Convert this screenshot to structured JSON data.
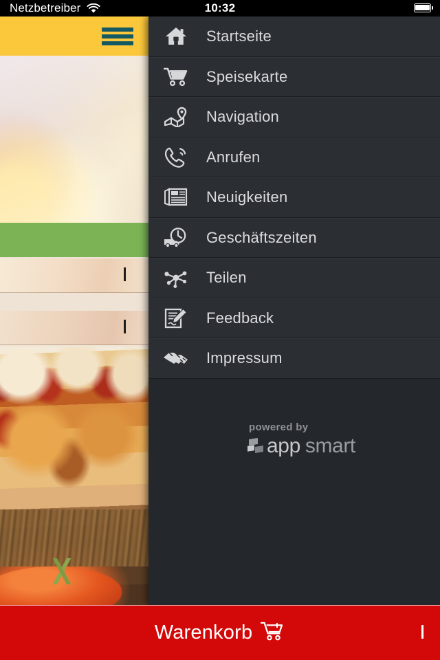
{
  "status_bar": {
    "carrier": "Netzbetreiber",
    "time": "10:32",
    "wifi_icon": "wifi-icon",
    "battery_icon": "battery-full-icon"
  },
  "app_behind": {
    "menu_button_icon": "hamburger-icon",
    "topbar_color": "#FBC83C",
    "accent_bar_color": "#7CB455",
    "rows": [
      {
        "chevron_icon": "chevron-right-icon"
      },
      {
        "chevron_icon": "chevron-right-icon"
      }
    ]
  },
  "drawer": {
    "background_color": "#24272C",
    "items": [
      {
        "label": "Startseite",
        "icon": "home-icon"
      },
      {
        "label": "Speisekarte",
        "icon": "shopping-cart-icon"
      },
      {
        "label": "Navigation",
        "icon": "map-pin-icon"
      },
      {
        "label": "Anrufen",
        "icon": "phone-icon"
      },
      {
        "label": "Neuigkeiten",
        "icon": "newspaper-icon"
      },
      {
        "label": "Geschäftszeiten",
        "icon": "delivery-clock-icon"
      },
      {
        "label": "Teilen",
        "icon": "share-icon"
      },
      {
        "label": "Feedback",
        "icon": "form-pencil-icon"
      },
      {
        "label": "Impressum",
        "icon": "handshake-icon"
      }
    ],
    "branding": {
      "powered_by": "powered by",
      "name_part_1": "app",
      "name_part_2": "smart",
      "logo_icon": "appsmart-logo-icon"
    }
  },
  "cart_bar": {
    "label": "Warenkorb",
    "cart_icon": "shopping-cart-icon",
    "arrow_icon": "chevron-right-icon",
    "background_color": "#D30808"
  }
}
